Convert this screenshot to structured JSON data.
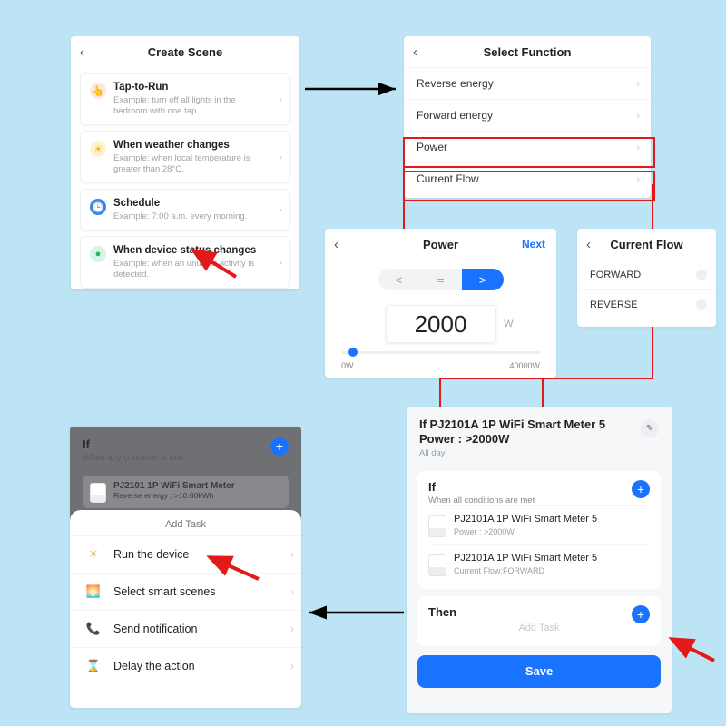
{
  "create": {
    "title": "Create Scene",
    "items": [
      {
        "title": "Tap-to-Run",
        "sub": "Example: turn off all lights in the bedroom with one tap."
      },
      {
        "title": "When weather changes",
        "sub": "Example: when local temperature is greater than 28°C."
      },
      {
        "title": "Schedule",
        "sub": "Example: 7:00 a.m. every morning."
      },
      {
        "title": "When device status changes",
        "sub": "Example: when an unusual activity is detected."
      }
    ]
  },
  "func": {
    "title": "Select Function",
    "rows": [
      "Reverse energy",
      "Forward energy",
      "Power",
      "Current Flow"
    ]
  },
  "power": {
    "title": "Power",
    "next": "Next",
    "ops": [
      "<",
      "=",
      ">"
    ],
    "value": "2000",
    "unit": "W",
    "min": "0W",
    "max": "40000W"
  },
  "flow": {
    "title": "Current Flow",
    "rows": [
      "FORWARD",
      "REVERSE"
    ]
  },
  "scene": {
    "title": "If PJ2101A 1P WiFi Smart Meter  5 Power : >2000W",
    "allday": "All day",
    "if_label": "If",
    "if_sub": "When all conditions are met",
    "conds": [
      {
        "name": "PJ2101A 1P WiFi Smart Meter 5",
        "det": "Power : >2000W"
      },
      {
        "name": "PJ2101A 1P WiFi Smart Meter 5",
        "det": "Current Flow:FORWARD"
      }
    ],
    "then_label": "Then",
    "add_task": "Add Task",
    "save": "Save"
  },
  "task": {
    "if_label": "If",
    "when": "When any condition is met",
    "dcond_name": "PJ2101 1P WiFi Smart Meter",
    "dcond_det": "Reverse energy : >10.00kWh",
    "sheet_title": "Add Task",
    "rows": [
      "Run the device",
      "Select smart scenes",
      "Send notification",
      "Delay the action"
    ]
  }
}
